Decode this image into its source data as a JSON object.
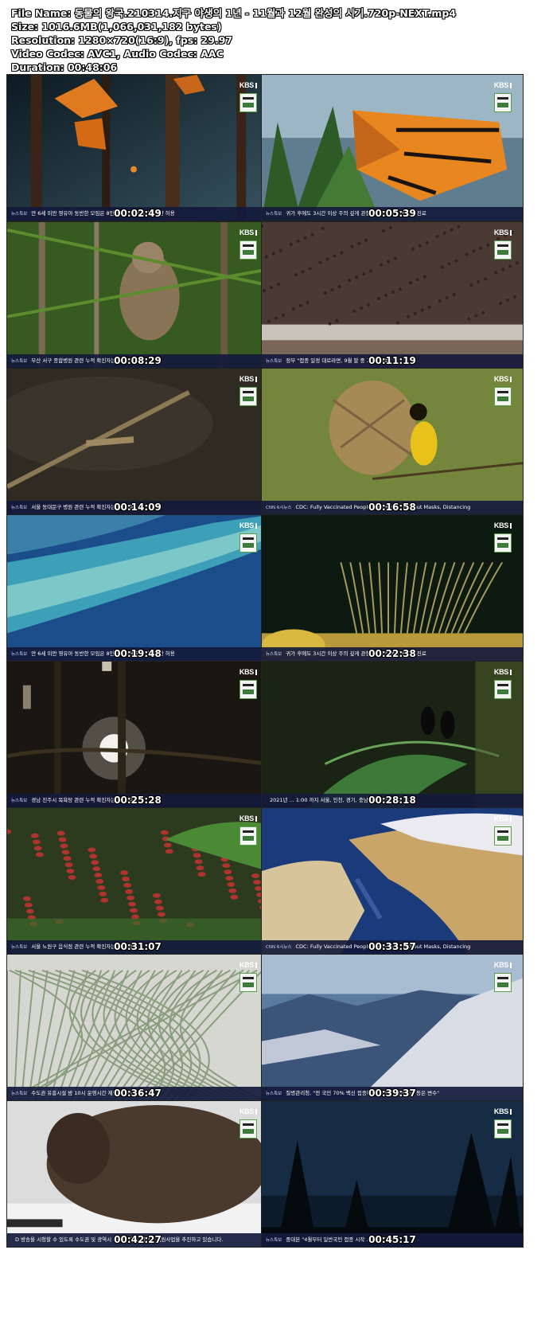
{
  "info": {
    "file_name_line": "File Name: 동물의 왕국.210314.지구 야생의 1년 - 11월과 12월 완성의 시기.720p-NEXT.mp4",
    "size_line": "Size: 1016.6MB(1,066,031,182 bytes)",
    "resolution_line": "Resolution: 1280×720(16:9), fps: 29.97",
    "codec_line": "Video Codec: AVC1, Audio Codec: AAC",
    "duration_line": "Duration: 00:48:06"
  },
  "channel_logo": "KBS",
  "thumbnails": [
    {
      "time": "00:02:49",
      "tag": "뉴스특보",
      "ticker": "만 6세 미만 영유아 동반한 모임은 8인까지 모임은 4인까지만 허용",
      "scene": "monarchs-forest"
    },
    {
      "time": "00:05:39",
      "tag": "뉴스특보",
      "ticker": "귀가 후에도 3시간 이상 주의 깊게 관찰 ... 반응 생기면 즉각 진료",
      "scene": "monarch-closeup"
    },
    {
      "time": "00:08:29",
      "tag": "뉴스특보",
      "ticker": "부산 서구 종합병원 관련 누적 확진자는 ... 기준",
      "scene": "lemur-trees"
    },
    {
      "time": "00:11:19",
      "tag": "뉴스특보",
      "ticker": "정부 \"접종 일정 대로라면, 9월 말 중 고 ... 예측\"",
      "scene": "bird-flock"
    },
    {
      "time": "00:14:09",
      "tag": "뉴스특보",
      "ticker": "서울 동대문구 병원 관련 누적 확진자는 ... 기준",
      "scene": "dark-branch"
    },
    {
      "time": "00:16:58",
      "tag": "CNN 6시뉴스",
      "ticker": "CDC: Fully Vaccinated People Can Hav ... without Masks, Distancing",
      "scene": "weaver-nest"
    },
    {
      "time": "00:19:48",
      "tag": "뉴스특보",
      "ticker": "만 6세 미만 영유아 동반한 모임은 8인까지 모임은 4인까지만 허용",
      "scene": "reef-aerial"
    },
    {
      "time": "00:22:38",
      "tag": "뉴스특보",
      "ticker": "귀가 후에도 3시간 이상 주의 깊게 관찰 ... 반응 생기면 즉각 진료",
      "scene": "sea-fan"
    },
    {
      "time": "00:25:28",
      "tag": "뉴스특보",
      "ticker": "경남 진주시 목욕탕 관련 누적 확진자는 ... 기준",
      "scene": "sun-trees"
    },
    {
      "time": "00:28:18",
      "tag": "",
      "ticker": "2021년 ... 1:00 까지 서울, 인천, 경기, 충남지 ... 지난 정보",
      "scene": "palm-bats"
    },
    {
      "time": "00:31:07",
      "tag": "뉴스특보",
      "ticker": "서울 노원구 음식점 관련 누적 확진자는 ... 기준",
      "scene": "red-crabs"
    },
    {
      "time": "00:33:57",
      "tag": "CNN 6시뉴스",
      "ticker": "CDC: Fully Vaccinated People Can Hav ... without Masks, Distancing",
      "scene": "earth-space"
    },
    {
      "time": "00:36:47",
      "tag": "뉴스특보",
      "ticker": "수도권 유흥시설 밤 10시 운영시간 제한 ... 4시",
      "scene": "frost-grass"
    },
    {
      "time": "00:39:37",
      "tag": "뉴스특보",
      "ticker": "질병관리청, \"전 국민 70% 백신 접종하면 ... 변이 바이러스 등은 변수\"",
      "scene": "snow-mountains"
    },
    {
      "time": "00:42:27",
      "tag": "",
      "ticker": "D 방송을 시청할 수 있도록 수도권 및 광역시 공공주택 ... 처리가 지원사업을 추진하고 있습니다.",
      "scene": "bison-snow"
    },
    {
      "time": "00:45:17",
      "tag": "뉴스특보",
      "ticker": "중대본 \"4월부터 일반국민 접종 시작 ... 우선 고려\"",
      "scene": "night-pines"
    }
  ]
}
